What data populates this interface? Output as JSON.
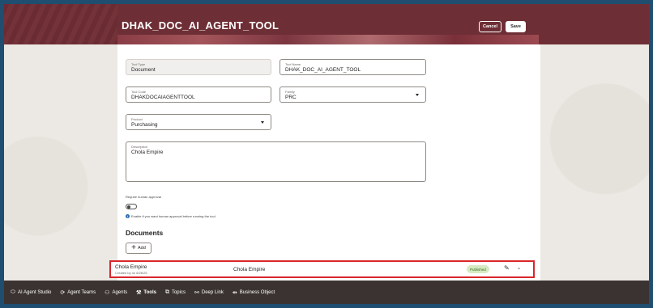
{
  "header": {
    "title": "DHAK_DOC_AI_AGENT_TOOL",
    "cancel_label": "Cancel",
    "save_label": "Save"
  },
  "form": {
    "tool_type": {
      "label": "Tool Type",
      "value": "Document"
    },
    "tool_name": {
      "label": "Tool Name",
      "value": "DHAK_DOC_AI_AGENT_TOOL"
    },
    "tool_code": {
      "label": "Tool Code",
      "value": "DHAKDOCAIAGENTTOOL"
    },
    "family": {
      "label": "Family",
      "value": "PRC"
    },
    "product": {
      "label": "Product",
      "value": "Purchasing"
    },
    "description": {
      "label": "Description",
      "value": "Chola Empire"
    },
    "approval": {
      "label": "Require human approval",
      "enabled": false,
      "help": "Enable if you want human approval before running the tool."
    }
  },
  "documents": {
    "heading": "Documents",
    "add_label": "Add",
    "rows": [
      {
        "name": "Chola Empire",
        "created": "Created by on 8/26/25",
        "description": "Chola Empire",
        "status": "Published"
      }
    ]
  },
  "bottom_nav": {
    "items": [
      {
        "label": "AI Agent Studio",
        "icon": "oracle-logo-icon"
      },
      {
        "label": "Agent Teams",
        "icon": "agent-teams-icon"
      },
      {
        "label": "Agents",
        "icon": "agents-icon"
      },
      {
        "label": "Tools",
        "icon": "tools-icon",
        "active": true
      },
      {
        "label": "Topics",
        "icon": "topics-icon"
      },
      {
        "label": "Deep Link",
        "icon": "link-icon"
      },
      {
        "label": "Business Object",
        "icon": "business-object-icon"
      }
    ]
  },
  "colors": {
    "header_bg": "#6e2e35",
    "highlight_border": "#d9262b",
    "status_bg": "#d7ebc3",
    "bottom_bar_bg": "#3b3331"
  }
}
